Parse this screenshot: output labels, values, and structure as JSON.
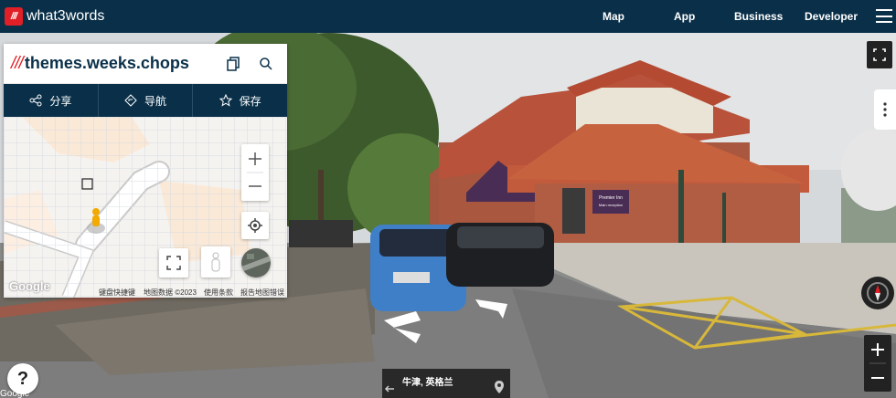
{
  "brand": {
    "mark": "///",
    "name": "what3words"
  },
  "nav": {
    "items": [
      "Map",
      "App",
      "Business",
      "Developer"
    ]
  },
  "panel": {
    "slashes": "///",
    "address": "themes.weeks.chops",
    "actions": {
      "share": "分享",
      "navigate": "导航",
      "save": "保存"
    }
  },
  "minimap": {
    "footer": {
      "shortcuts": "键盘快捷键",
      "map_data": "地图数据 ©2023",
      "terms": "使用条款",
      "report": "报告地图错误"
    },
    "google": "Google"
  },
  "streetview": {
    "location": "牛津, 英格兰",
    "google": "Google",
    "sign_top": "Premier Inn",
    "sign_bottom": "Main reception"
  },
  "help_label": "?",
  "colors": {
    "navy": "#0a3049",
    "red": "#e11f26"
  }
}
